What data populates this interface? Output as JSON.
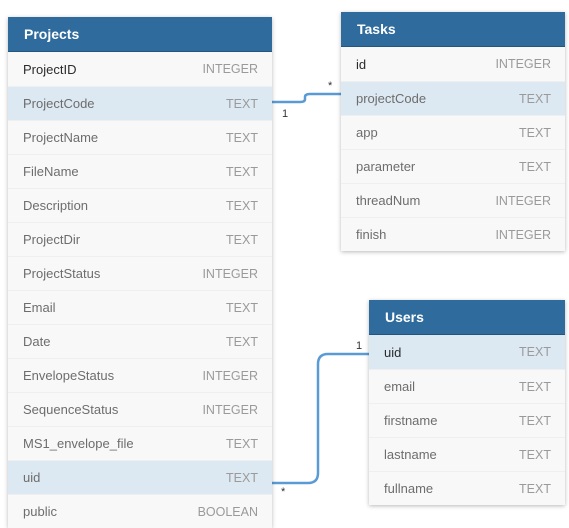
{
  "colors": {
    "header": "#2f6b9c",
    "highlight": "#dde9f2",
    "link": "#5b9bd5"
  },
  "tables": [
    {
      "id": "projects",
      "title": "Projects",
      "rows": [
        {
          "name": "ProjectID",
          "type": "INTEGER",
          "pk": true
        },
        {
          "name": "ProjectCode",
          "type": "TEXT",
          "highlight": true
        },
        {
          "name": "ProjectName",
          "type": "TEXT"
        },
        {
          "name": "FileName",
          "type": "TEXT"
        },
        {
          "name": "Description",
          "type": "TEXT"
        },
        {
          "name": "ProjectDir",
          "type": "TEXT"
        },
        {
          "name": "ProjectStatus",
          "type": "INTEGER"
        },
        {
          "name": "Email",
          "type": "TEXT"
        },
        {
          "name": "Date",
          "type": "TEXT"
        },
        {
          "name": "EnvelopeStatus",
          "type": "INTEGER"
        },
        {
          "name": "SequenceStatus",
          "type": "INTEGER"
        },
        {
          "name": "MS1_envelope_file",
          "type": "TEXT"
        },
        {
          "name": "uid",
          "type": "TEXT",
          "highlight": true
        },
        {
          "name": "public",
          "type": "BOOLEAN"
        }
      ]
    },
    {
      "id": "tasks",
      "title": "Tasks",
      "rows": [
        {
          "name": "id",
          "type": "INTEGER",
          "pk": true
        },
        {
          "name": "projectCode",
          "type": "TEXT",
          "highlight": true
        },
        {
          "name": "app",
          "type": "TEXT"
        },
        {
          "name": "parameter",
          "type": "TEXT"
        },
        {
          "name": "threadNum",
          "type": "INTEGER"
        },
        {
          "name": "finish",
          "type": "INTEGER"
        }
      ]
    },
    {
      "id": "users",
      "title": "Users",
      "rows": [
        {
          "name": "uid",
          "type": "TEXT",
          "pk": true,
          "highlight": true
        },
        {
          "name": "email",
          "type": "TEXT"
        },
        {
          "name": "firstname",
          "type": "TEXT"
        },
        {
          "name": "lastname",
          "type": "TEXT"
        },
        {
          "name": "fullname",
          "type": "TEXT"
        }
      ]
    }
  ],
  "relations": [
    {
      "from": "Projects.ProjectCode",
      "to": "Tasks.projectCode",
      "from_card": "1",
      "to_card": "*"
    },
    {
      "from": "Projects.uid",
      "to": "Users.uid",
      "from_card": "*",
      "to_card": "1"
    }
  ]
}
